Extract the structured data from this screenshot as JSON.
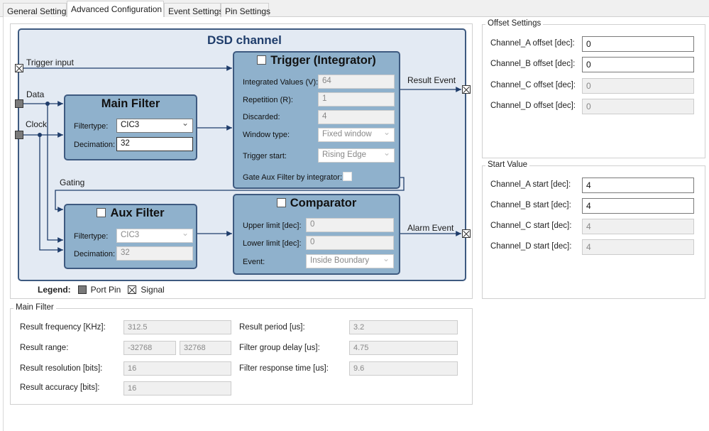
{
  "tabs": [
    {
      "label": "General Settings"
    },
    {
      "label": "Advanced Configuration",
      "active": true
    },
    {
      "label": "Event Settings"
    },
    {
      "label": "Pin Settings"
    }
  ],
  "diagram": {
    "title": "DSD channel",
    "trigger_input_label": "Trigger input",
    "data_label": "Data",
    "clock_label": "Clock",
    "gating_label": "Gating",
    "result_event_label": "Result Event",
    "alarm_event_label": "Alarm Event",
    "main_filter": {
      "title": "Main Filter",
      "filtertype_label": "Filtertype:",
      "filtertype_value": "CIC3",
      "decimation_label": "Decimation:",
      "decimation_value": "32"
    },
    "trigger": {
      "title": "Trigger (Integrator)",
      "enabled": false,
      "integrated_label": "Integrated Values (V):",
      "integrated_value": "64",
      "repetition_label": "Repetition (R):",
      "repetition_value": "1",
      "discarded_label": "Discarded:",
      "discarded_value": "4",
      "window_label": "Window type:",
      "window_value": "Fixed window",
      "start_label": "Trigger start:",
      "start_value": "Rising Edge",
      "gate_label": "Gate Aux Filter by integrator:",
      "gate_checked": false
    },
    "aux_filter": {
      "title": "Aux Filter",
      "enabled": false,
      "filtertype_label": "Filtertype:",
      "filtertype_value": "CIC3",
      "decimation_label": "Decimation:",
      "decimation_value": "32"
    },
    "comparator": {
      "title": "Comparator",
      "enabled": false,
      "upper_label": "Upper limit [dec]:",
      "upper_value": "0",
      "lower_label": "Lower limit [dec]:",
      "lower_value": "0",
      "event_label": "Event:",
      "event_value": "Inside Boundary"
    },
    "legend": {
      "title": "Legend:",
      "port_pin": "Port Pin",
      "signal": "Signal"
    },
    "colors": {
      "panel_bg": "#e3eaf3",
      "block_bg": "#8fb1cc",
      "border": "#3e5a80",
      "title": "#1f3d6b"
    }
  },
  "main_filter_group": {
    "title": "Main Filter",
    "freq_label": "Result frequency [KHz]:",
    "freq_value": "312.5",
    "range_label": "Result range:",
    "range_min": "-32768",
    "range_max": "32768",
    "resolution_label": "Result resolution [bits]:",
    "resolution_value": "16",
    "accuracy_label": "Result accuracy [bits]:",
    "accuracy_value": "16",
    "period_label": "Result period [us]:",
    "period_value": "3.2",
    "group_delay_label": "Filter group delay [us]:",
    "group_delay_value": "4.75",
    "response_label": "Filter response time [us]:",
    "response_value": "9.6"
  },
  "offset_settings": {
    "title": "Offset Settings",
    "rows": [
      {
        "label": "Channel_A offset [dec]:",
        "value": "0"
      },
      {
        "label": "Channel_B offset [dec]:",
        "value": "0"
      },
      {
        "label": "Channel_C offset [dec]:",
        "value": "0"
      },
      {
        "label": "Channel_D offset [dec]:",
        "value": "0"
      }
    ]
  },
  "start_value": {
    "title": "Start Value",
    "rows": [
      {
        "label": "Channel_A start [dec]:",
        "value": "4"
      },
      {
        "label": "Channel_B start [dec]:",
        "value": "4"
      },
      {
        "label": "Channel_C start [dec]:",
        "value": "4"
      },
      {
        "label": "Channel_D start [dec]:",
        "value": "4"
      }
    ]
  }
}
